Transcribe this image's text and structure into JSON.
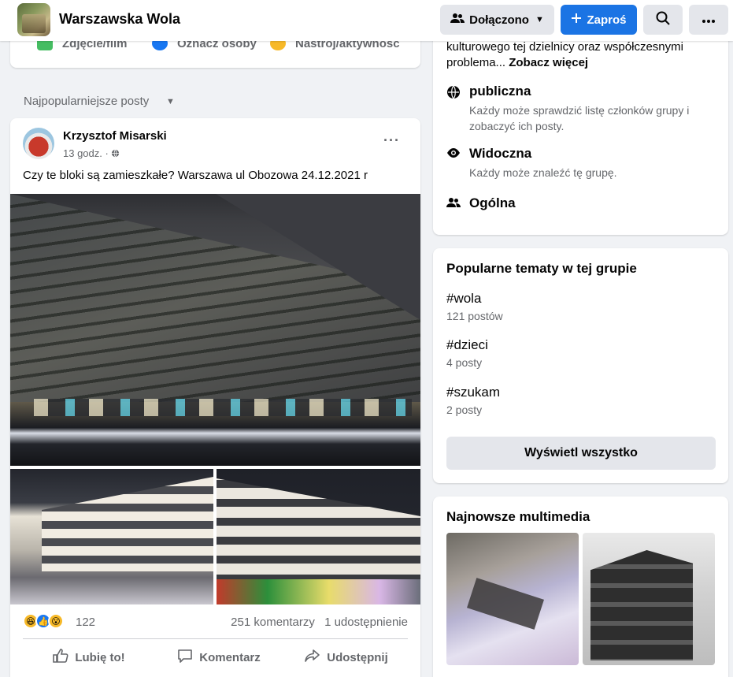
{
  "header": {
    "group_name": "Warszawska Wola",
    "joined_label": "Dołączono",
    "invite_label": "Zaproś"
  },
  "composer": {
    "items": [
      "Zdjęcie/film",
      "Oznacz osoby",
      "Nastrój/aktywność"
    ]
  },
  "feed": {
    "sort_label": "Najpopularniejsze posty"
  },
  "post": {
    "author": "Krzysztof Misarski",
    "time": "13 godz.",
    "text": "Czy te bloki są zamieszkałe? Warszawa ul Obozowa 24.12.2021 r",
    "reaction_count": "122",
    "comments": "251 komentarzy",
    "shares": "1 udostępnienie",
    "actions": {
      "like": "Lubię to!",
      "comment": "Komentarz",
      "share": "Udostępnij"
    }
  },
  "about": {
    "text_start": "kulturowego tej dzielnicy oraz współczesnymi problema...",
    "see_more": "Zobacz więcej",
    "privacy": [
      {
        "title": "publiczna",
        "desc": "Każdy może sprawdzić listę członków grupy i zobaczyć ich posty.",
        "icon": "globe-icon"
      },
      {
        "title": "Widoczna",
        "desc": "Każdy może znaleźć tę grupę.",
        "icon": "eye-icon"
      },
      {
        "title": "Ogólna",
        "desc": "",
        "icon": "people-icon"
      }
    ]
  },
  "topics": {
    "title": "Popularne tematy w tej grupie",
    "items": [
      {
        "tag": "#wola",
        "count": "121 postów"
      },
      {
        "tag": "#dzieci",
        "count": "4 posty"
      },
      {
        "tag": "#szukam",
        "count": "2 posty"
      }
    ],
    "show_all": "Wyświetl wszystko"
  },
  "media": {
    "title": "Najnowsze multimedia"
  },
  "colors": {
    "accent": "#1b74e4",
    "background": "#f0f2f5",
    "secondary_text": "#65676b"
  }
}
